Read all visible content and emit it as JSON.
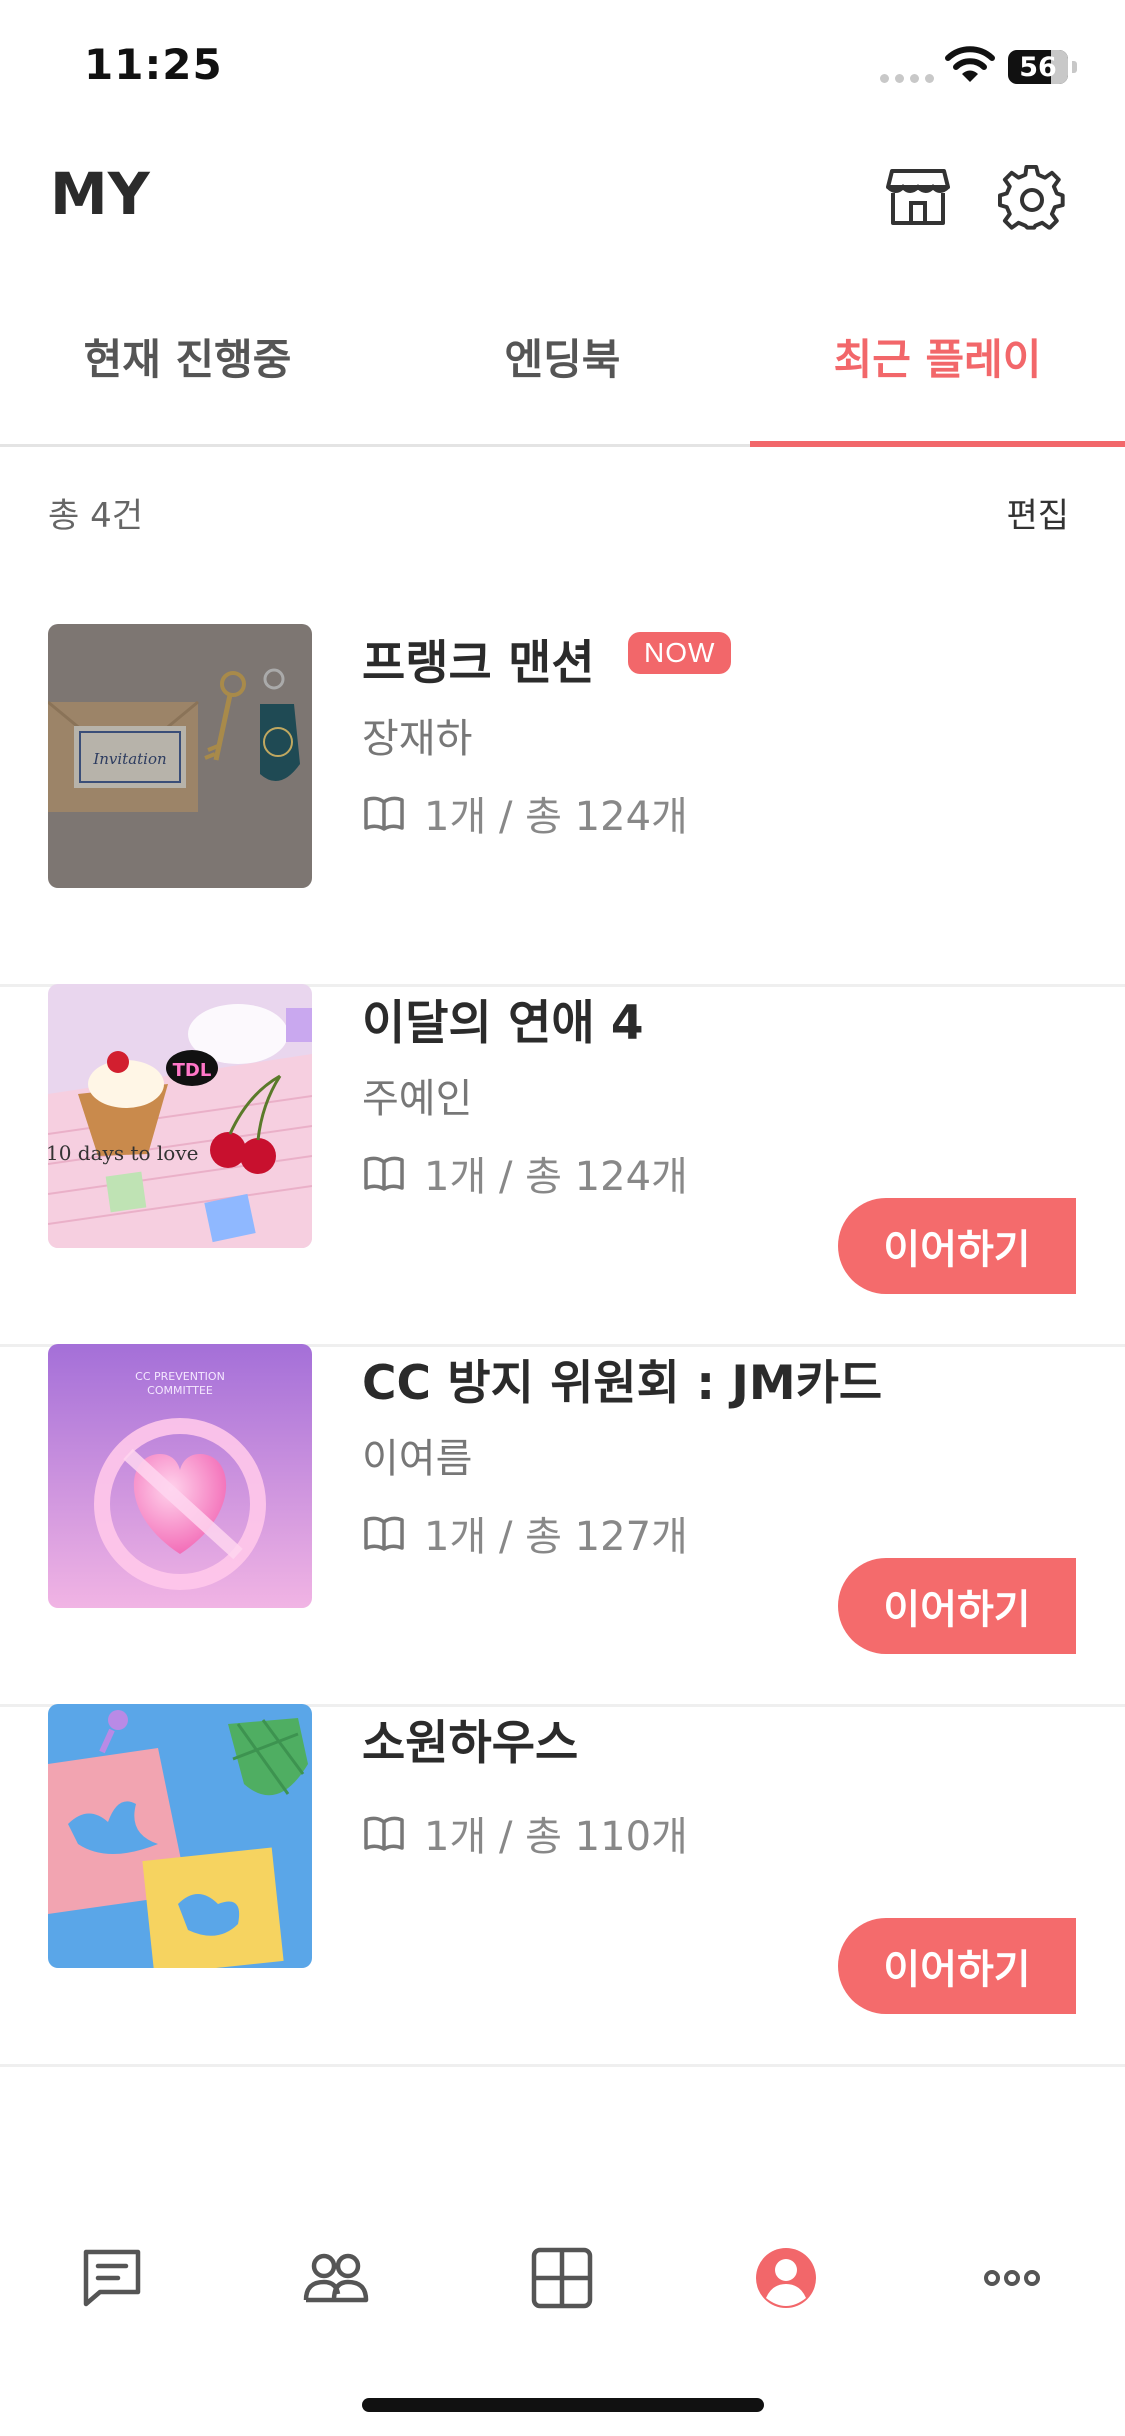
{
  "status_bar": {
    "time": "11:25",
    "battery": "56"
  },
  "header": {
    "title": "MY",
    "store_icon": "store-icon",
    "settings_icon": "gear-icon"
  },
  "tabs": [
    {
      "label": "현재 진행중",
      "active": false
    },
    {
      "label": "엔딩북",
      "active": false
    },
    {
      "label": "최근 플레이",
      "active": true
    }
  ],
  "summary": {
    "total": "총 4건",
    "edit": "편집"
  },
  "items": [
    {
      "title": "프랭크 맨션",
      "badge": "NOW",
      "author": "장재하",
      "progress": "1개 / 총 124개",
      "action": ""
    },
    {
      "title": "이달의 연애 4",
      "author": "주예인",
      "progress": "1개 / 총 124개",
      "action": "이어하기"
    },
    {
      "title": "CC 방지 위원회 : JM카드",
      "author": "이여름",
      "progress": "1개 / 총 127개",
      "action": "이어하기"
    },
    {
      "title": "소원하우스",
      "author": "",
      "progress": "1개 / 총 110개",
      "action": "이어하기"
    }
  ],
  "thumbnails": {
    "item1": {
      "text": "Invitation"
    },
    "item2": {
      "badge": "TDL",
      "text": "10 days to love"
    },
    "item3": {
      "text_line1": "CC PREVENTION",
      "text_line2": "COMMITTEE"
    }
  },
  "bottom_nav": [
    {
      "icon": "chat-icon",
      "active": false
    },
    {
      "icon": "people-icon",
      "active": false
    },
    {
      "icon": "grid-icon",
      "active": false
    },
    {
      "icon": "profile-icon",
      "active": true
    },
    {
      "icon": "more-icon",
      "active": false
    }
  ],
  "colors": {
    "accent": "#f2676a",
    "text": "#2b2b2b",
    "muted": "#888888",
    "divider": "#efefef"
  }
}
